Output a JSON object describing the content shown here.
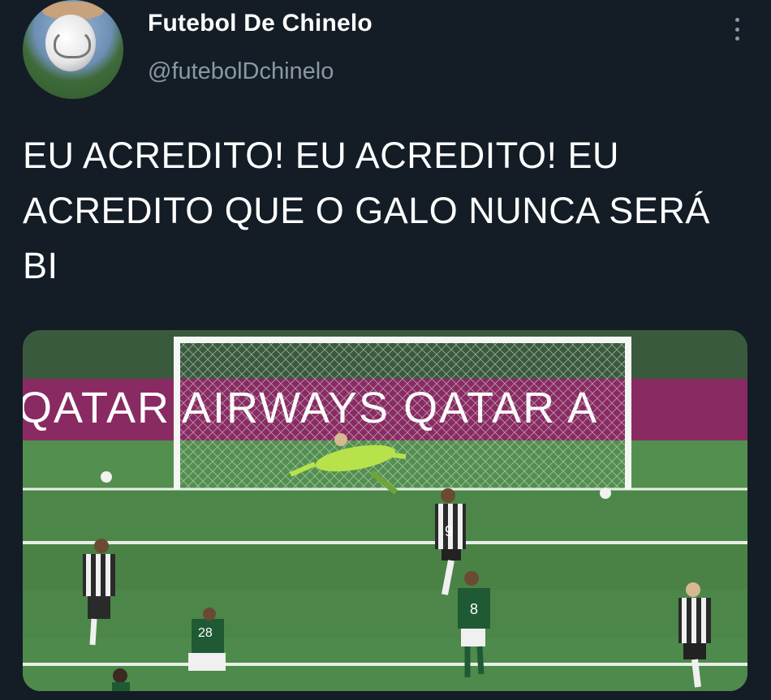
{
  "tweet": {
    "display_name": "Futebol De Chinelo",
    "handle": "@futebolDchinelo",
    "text": "EU ACREDITO! EU ACREDITO! EU ACREDITO QUE O GALO NUNCA SERÁ BI",
    "avatar_icon": "football-avatar-icon",
    "more_icon": "more-vertical-icon"
  },
  "media": {
    "banner_text": "QATAR AIRWAYS QATAR A",
    "shirt_numbers": [
      "9",
      "8",
      "28"
    ]
  },
  "colors": {
    "background": "#141d26",
    "text": "#ffffff",
    "secondary_text": "#8899a6",
    "banner": "#8a2a63",
    "pitch": "#4e8b4b"
  }
}
